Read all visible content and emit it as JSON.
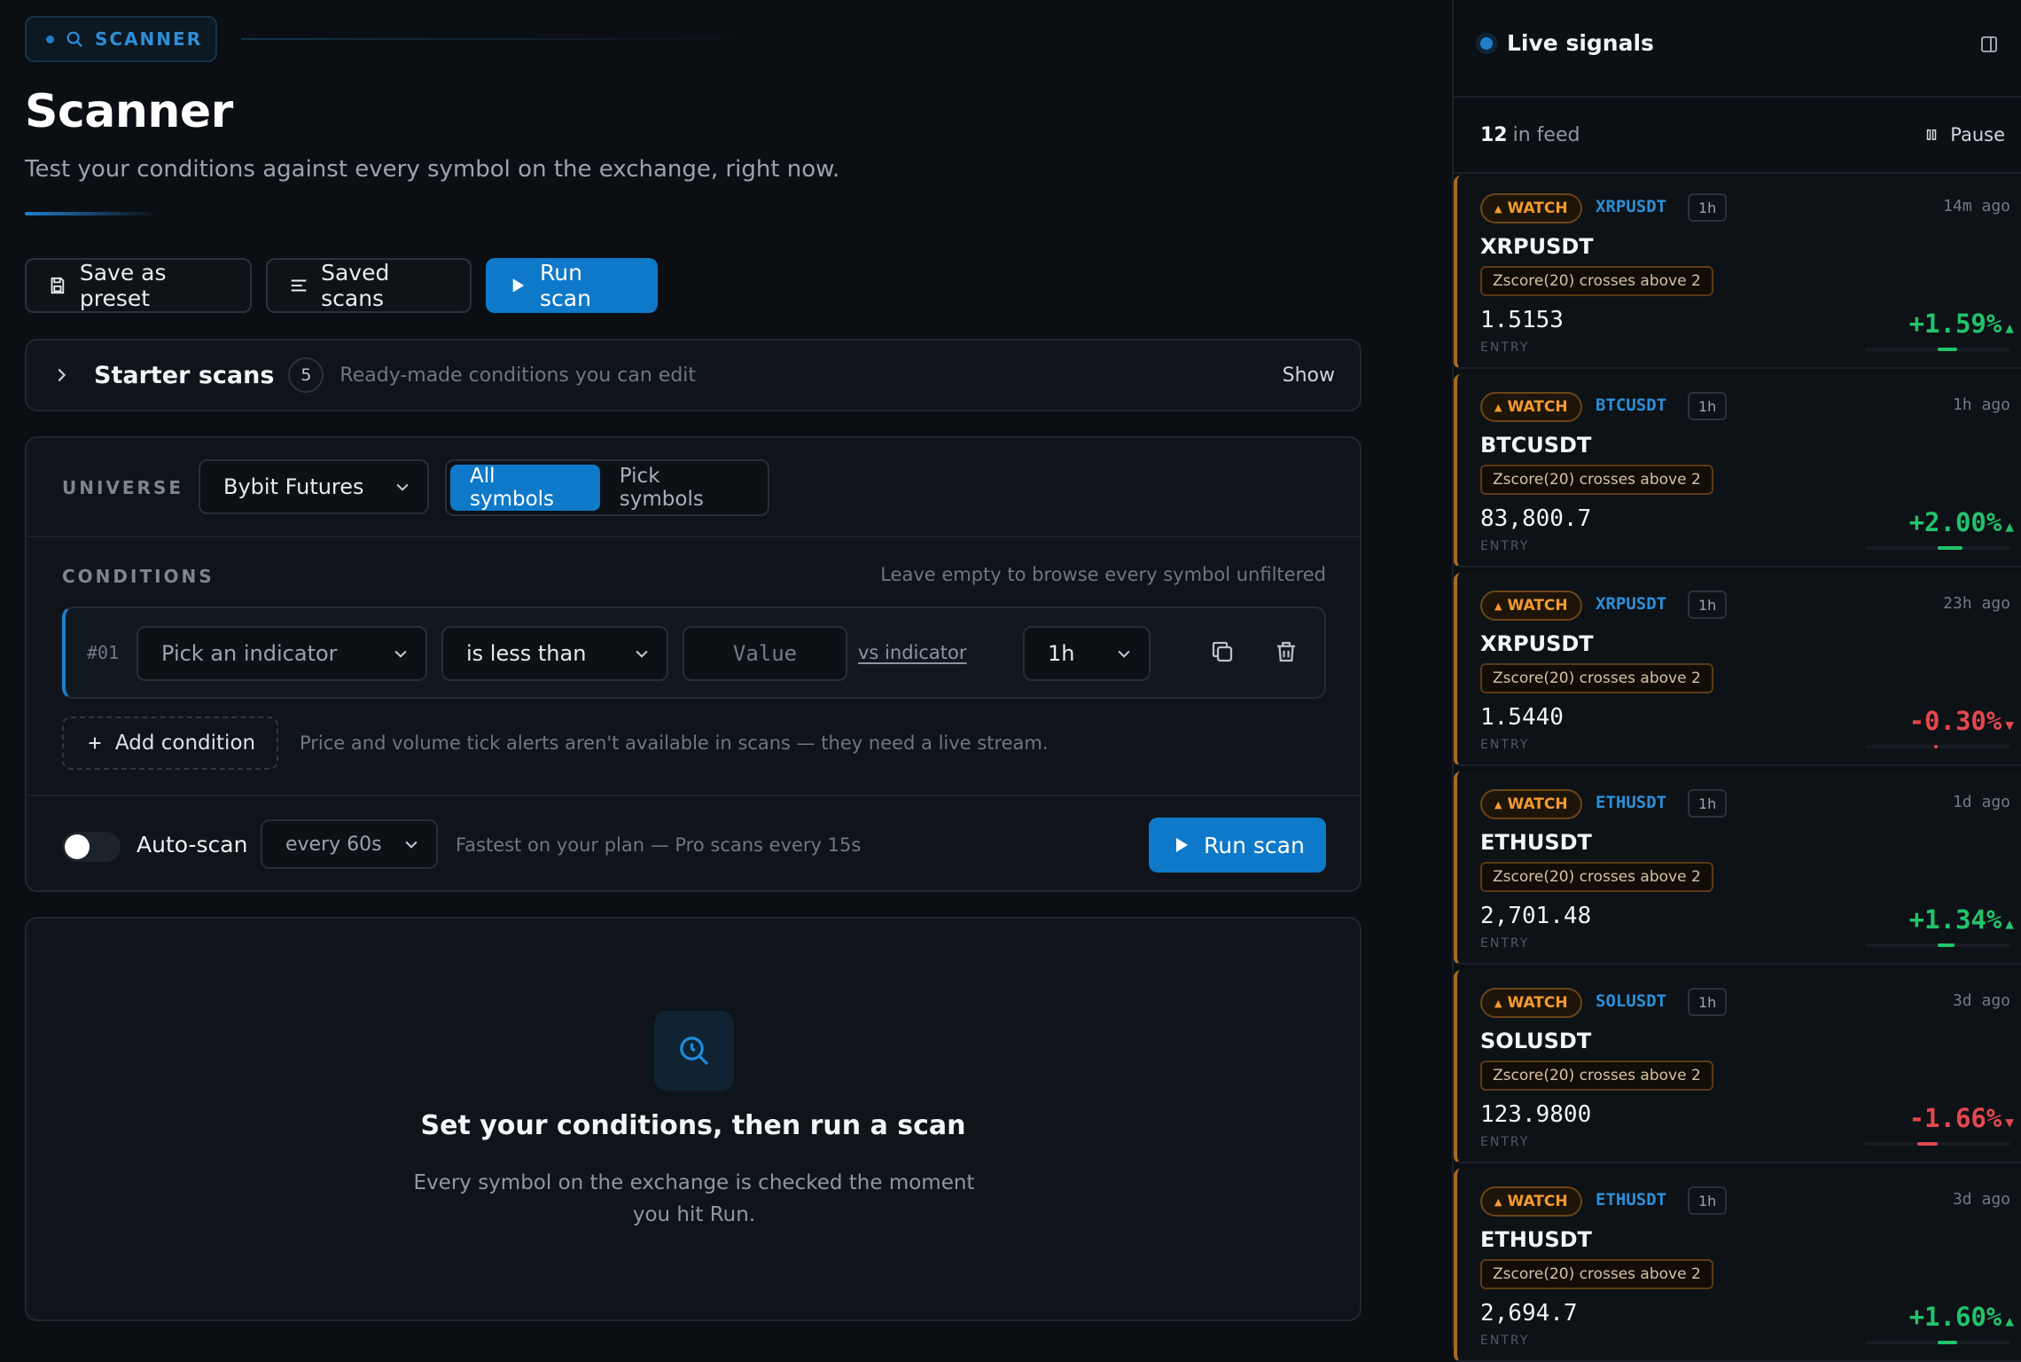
{
  "header": {
    "pill_label": "SCANNER",
    "title": "Scanner",
    "subtitle": "Test your conditions against every symbol on the exchange, right now."
  },
  "toolbar": {
    "save_preset": "Save as preset",
    "saved_scans": "Saved scans",
    "run_scan": "Run scan"
  },
  "starter": {
    "label": "Starter scans",
    "count": "5",
    "description": "Ready-made conditions you can edit",
    "toggle": "Show"
  },
  "universe": {
    "label": "UNIVERSE",
    "exchange": "Bybit Futures",
    "options": [
      "All symbols",
      "Pick symbols"
    ],
    "selected": "All symbols"
  },
  "conditions": {
    "label": "CONDITIONS",
    "hint": "Leave empty to browse every symbol unfiltered",
    "rows": [
      {
        "number": "#01",
        "indicator": "Pick an indicator",
        "operator": "is less than",
        "value_placeholder": "Value",
        "vs_link": "vs indicator",
        "timeframe": "1h"
      }
    ],
    "add_label": "Add condition",
    "add_hint": "Price and volume tick alerts aren't available in scans — they need a live stream."
  },
  "auto_scan": {
    "label": "Auto-scan",
    "enabled": false,
    "interval": "every 60s",
    "hint": "Fastest on your plan — Pro scans every 15s",
    "run_label": "Run scan"
  },
  "empty_state": {
    "title": "Set your conditions, then run a scan",
    "description": "Every symbol on the exchange is checked the moment you hit Run."
  },
  "sidebar": {
    "title": "Live signals",
    "feed_count": "12",
    "feed_suffix": "in feed",
    "pause_label": "Pause",
    "signals": [
      {
        "badge": "WATCH",
        "symbol_tag": "XRPUSDT",
        "timeframe": "1h",
        "ago": "14m ago",
        "symbol": "XRPUSDT",
        "condition": "Zscore(20) crosses above 2",
        "price": "1.5153",
        "entry_label": "ENTRY",
        "change": "+1.59%",
        "direction": "up",
        "change_value": 1.59
      },
      {
        "badge": "WATCH",
        "symbol_tag": "BTCUSDT",
        "timeframe": "1h",
        "ago": "1h ago",
        "symbol": "BTCUSDT",
        "condition": "Zscore(20) crosses above 2",
        "price": "83,800.7",
        "entry_label": "ENTRY",
        "change": "+2.00%",
        "direction": "up",
        "change_value": 2.0
      },
      {
        "badge": "WATCH",
        "symbol_tag": "XRPUSDT",
        "timeframe": "1h",
        "ago": "23h ago",
        "symbol": "XRPUSDT",
        "condition": "Zscore(20) crosses above 2",
        "price": "1.5440",
        "entry_label": "ENTRY",
        "change": "-0.30%",
        "direction": "down",
        "change_value": -0.3
      },
      {
        "badge": "WATCH",
        "symbol_tag": "ETHUSDT",
        "timeframe": "1h",
        "ago": "1d ago",
        "symbol": "ETHUSDT",
        "condition": "Zscore(20) crosses above 2",
        "price": "2,701.48",
        "entry_label": "ENTRY",
        "change": "+1.34%",
        "direction": "up",
        "change_value": 1.34
      },
      {
        "badge": "WATCH",
        "symbol_tag": "SOLUSDT",
        "timeframe": "1h",
        "ago": "3d ago",
        "symbol": "SOLUSDT",
        "condition": "Zscore(20) crosses above 2",
        "price": "123.9800",
        "entry_label": "ENTRY",
        "change": "-1.66%",
        "direction": "down",
        "change_value": -1.66
      },
      {
        "badge": "WATCH",
        "symbol_tag": "ETHUSDT",
        "timeframe": "1h",
        "ago": "3d ago",
        "symbol": "ETHUSDT",
        "condition": "Zscore(20) crosses above 2",
        "price": "2,694.7",
        "entry_label": "ENTRY",
        "change": "+1.60%",
        "direction": "up",
        "change_value": 1.6
      }
    ]
  },
  "colors": {
    "accent": "#0f79c9",
    "watch": "#f39a2f",
    "positive": "#21c46b",
    "negative": "#e5484d"
  }
}
